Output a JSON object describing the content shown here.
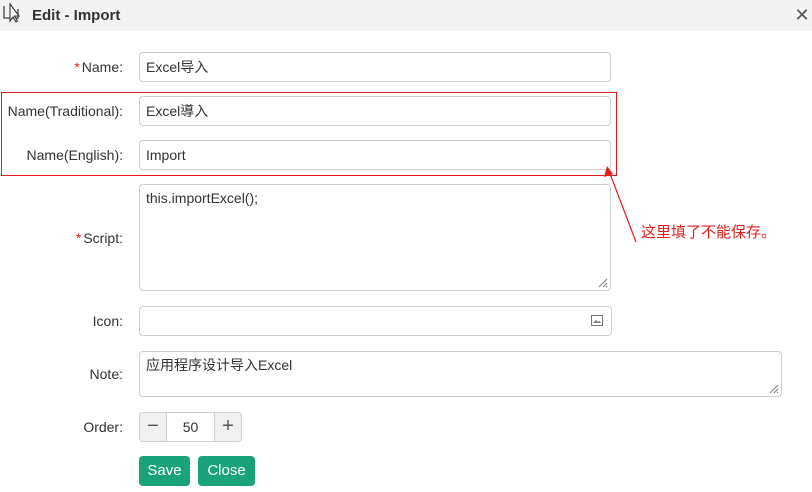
{
  "window": {
    "title": "Edit - Import",
    "icon": "window-edit-icon"
  },
  "labels": {
    "name": "Name:",
    "name_traditional": "Name(Traditional):",
    "name_english": "Name(English):",
    "script": "Script:",
    "icon": "Icon:",
    "note": "Note:",
    "order": "Order:",
    "save": "Save",
    "close": "Close",
    "required_mark": "*"
  },
  "fields": {
    "name": "Excel导入",
    "name_traditional": "Excel導入",
    "name_english": "Import",
    "script": "this.importExcel();",
    "icon": "",
    "note": "应用程序设计导入Excel",
    "order": "50"
  },
  "annotation": {
    "text": "这里填了不能保存。",
    "color": "#e02020"
  },
  "colors": {
    "accent": "#1aa37a",
    "required": "#e02020",
    "annotation": "#e02020"
  }
}
